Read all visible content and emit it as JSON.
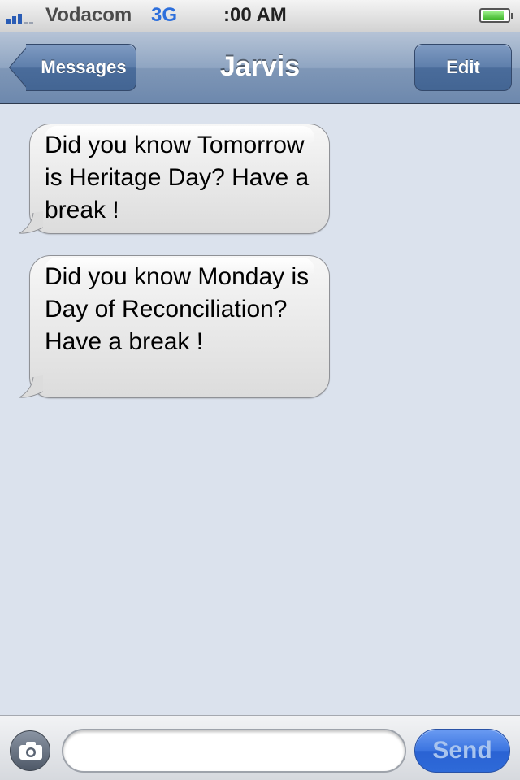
{
  "status_bar": {
    "carrier": "Vodacom",
    "network": "3G",
    "time": ":00 AM",
    "signal_bars": 3,
    "battery_icon": "battery-icon"
  },
  "nav_bar": {
    "back_label": "Messages",
    "title": "Jarvis",
    "edit_label": "Edit"
  },
  "messages": [
    {
      "text": "Did you know Tomorrow is Heritage Day? Have a break !"
    },
    {
      "text": "Did you know Monday is Day of Reconciliation? Have a break !"
    }
  ],
  "input_bar": {
    "field_value": "",
    "send_label": "Send",
    "camera_icon": "camera-icon"
  },
  "colors": {
    "background": "#dbe2ed",
    "nav_bar": "#7f97b7",
    "send_button": "#3b74e0",
    "network_text": "#2d6fdc"
  }
}
